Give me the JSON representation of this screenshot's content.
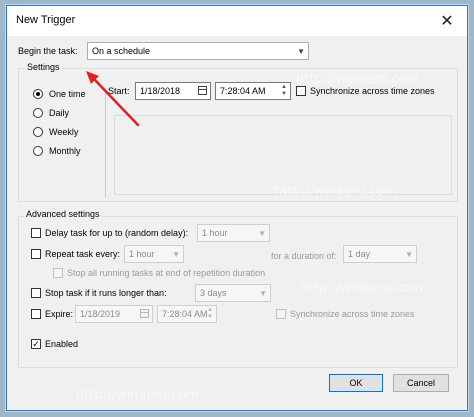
{
  "window": {
    "title": "New Trigger"
  },
  "begin": {
    "label": "Begin the task:",
    "value": "On a schedule"
  },
  "settings": {
    "group_label": "Settings",
    "options": [
      "One time",
      "Daily",
      "Weekly",
      "Monthly"
    ],
    "selected": "One time",
    "start_label": "Start:",
    "start_date": "1/18/2018",
    "start_time": "7:28:04 AM",
    "sync_label": "Synchronize across time zones"
  },
  "advanced": {
    "group_label": "Advanced settings",
    "delay_label": "Delay task for up to (random delay):",
    "delay_value": "1 hour",
    "repeat_label": "Repeat task every:",
    "repeat_value": "1 hour",
    "duration_label": "for a duration of:",
    "duration_value": "1 day",
    "stop_running_label": "Stop all running tasks at end of repetition duration",
    "stop_longer_label": "Stop task if it runs longer than:",
    "stop_longer_value": "3 days",
    "expire_label": "Expire:",
    "expire_date": "1/18/2019",
    "expire_time": "7:28:04 AM",
    "expire_sync_label": "Synchronize across time zones",
    "enabled_label": "Enabled",
    "enabled_checked": true
  },
  "buttons": {
    "ok": "OK",
    "cancel": "Cancel"
  },
  "watermark": "http://winaero.com",
  "colors": {
    "accent": "#0078d7",
    "annotation_arrow": "#e02020"
  }
}
